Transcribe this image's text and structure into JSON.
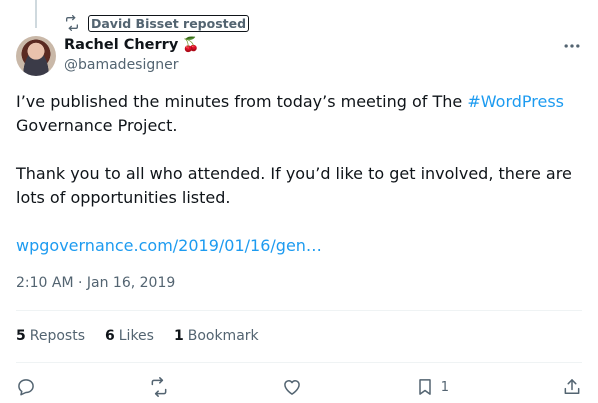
{
  "repost": {
    "label": "David Bisset reposted",
    "icon": "repost-icon"
  },
  "author": {
    "name": "Rachel Cherry",
    "emoji": "🍒",
    "handle": "@bamadesigner"
  },
  "tweet": {
    "line1_prefix": "I’ve published the minutes from today’s meeting of The ",
    "hashtag": "#WordPress",
    "line1_suffix": "Governance Project.",
    "paragraph2": "Thank you to all who attended. If you’d like to get involved, there are lots of opportunities listed.",
    "link": "wpgovernance.com/2019/01/16/gen…"
  },
  "timestamp": "2:10 AM · Jan 16, 2019",
  "stats": {
    "reposts_count": "5",
    "reposts_label": "Reposts",
    "likes_count": "6",
    "likes_label": "Likes",
    "bookmarks_count": "1",
    "bookmarks_label": "Bookmark"
  },
  "actions": {
    "bookmark_count": "1"
  },
  "colors": {
    "accent": "#1d9bf0",
    "secondary_text": "#536471",
    "primary_text": "#0f1419",
    "divider": "#eff3f4"
  }
}
